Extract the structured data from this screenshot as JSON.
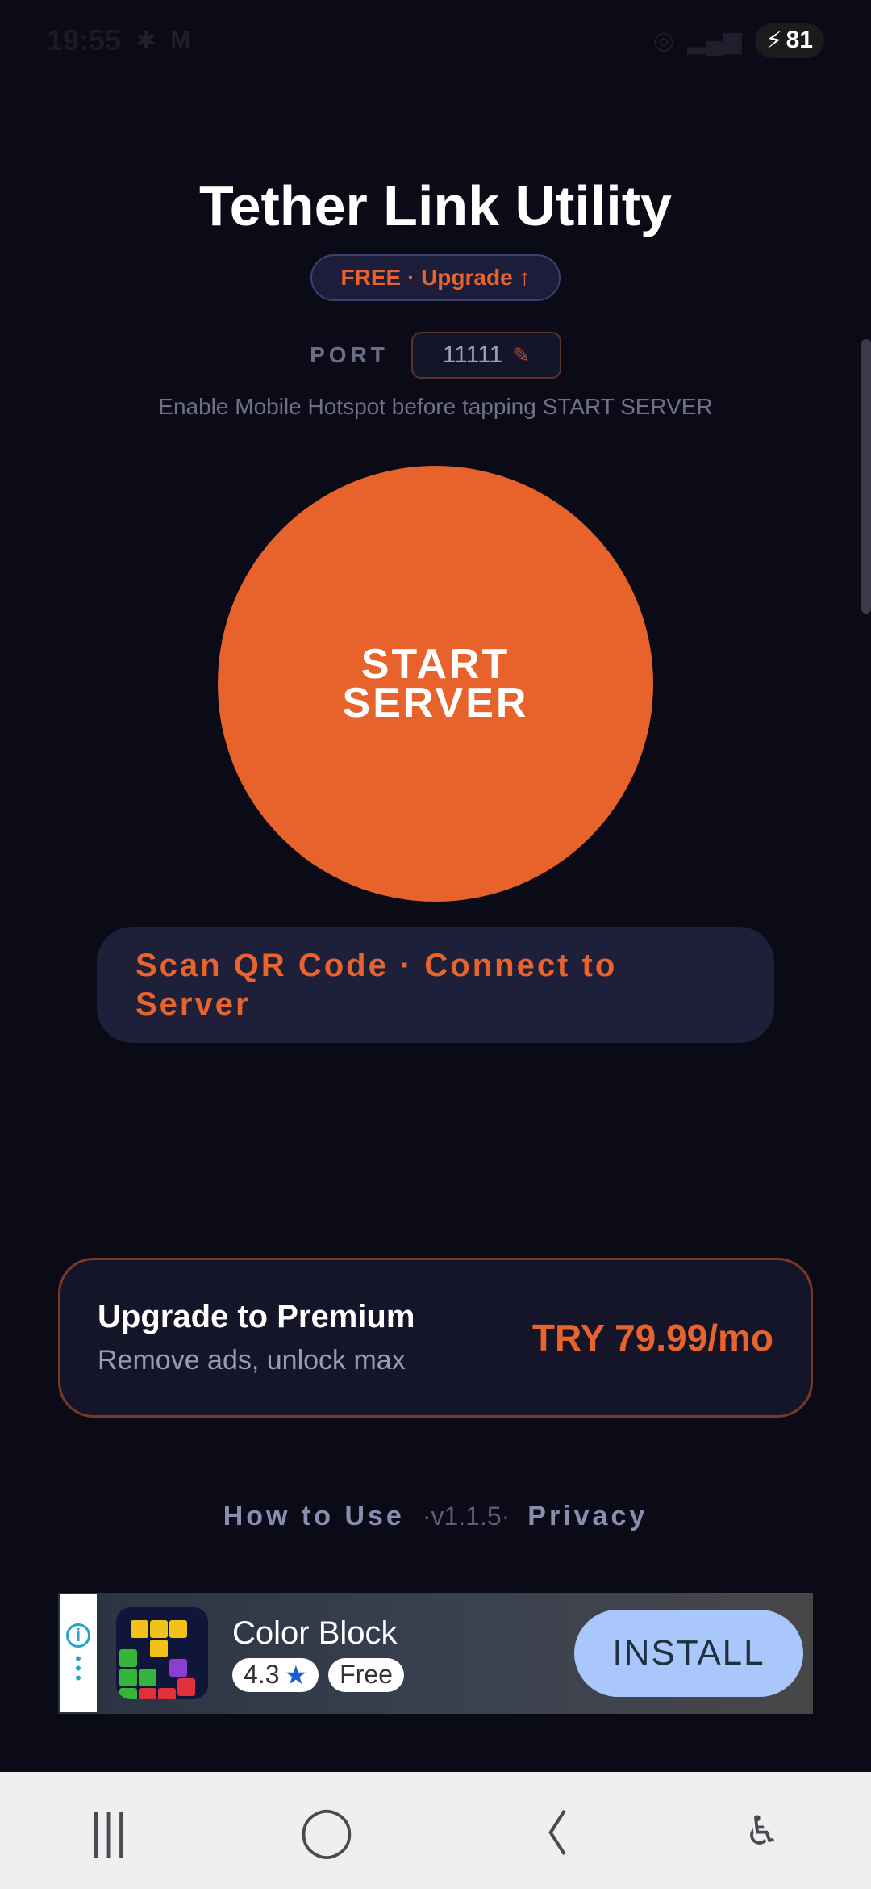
{
  "status_bar": {
    "time": "19:55",
    "battery": "81"
  },
  "app": {
    "title": "Tether Link Utility",
    "plan_label": "FREE · Upgrade ↑",
    "port_label": "PORT",
    "port_value": "11111",
    "hint": "Enable Mobile Hotspot before tapping START SERVER",
    "start_button": "START SERVER",
    "qr_button": "Scan QR Code · Connect to Server"
  },
  "premium": {
    "title": "Upgrade to Premium",
    "subtitle": "Remove ads, unlock max",
    "price": "TRY 79.99/mo"
  },
  "footer": {
    "how_to_use": "How to Use",
    "version": "·v1.1.5·",
    "privacy": "Privacy"
  },
  "ad": {
    "app_name": "Color Block",
    "rating": "4.3",
    "price": "Free",
    "install": "INSTALL"
  },
  "colors": {
    "accent": "#e8622c",
    "background": "#0b0b17",
    "card": "#1e1f38"
  }
}
